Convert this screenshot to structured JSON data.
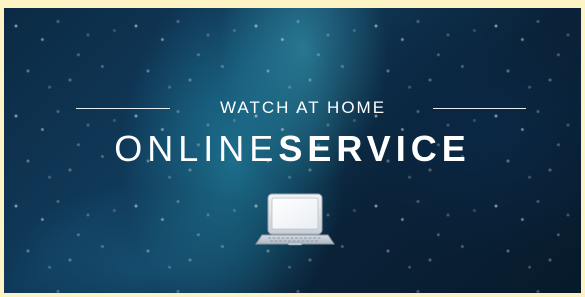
{
  "banner": {
    "tagline": "WATCH AT HOME",
    "headline_light": "ONLINE",
    "headline_bold": "SERVICE",
    "icon": "laptop-icon",
    "colors": {
      "background": "#0b2a44",
      "accent": "#2aa3be",
      "text": "#ffffff",
      "frame": "#fdf3c4"
    }
  }
}
